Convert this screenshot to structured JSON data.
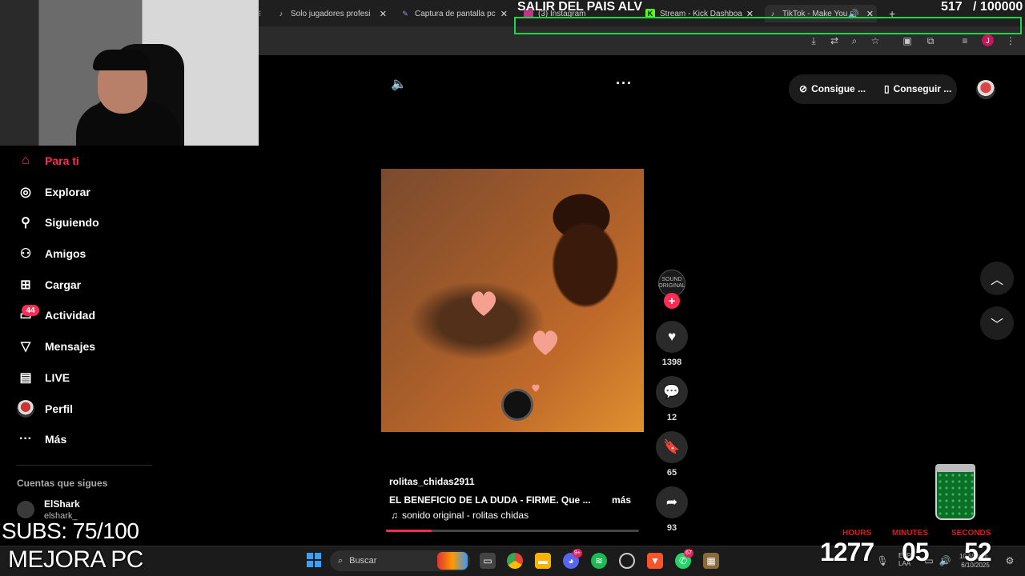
{
  "browser": {
    "tabs": [
      {
        "title": "Solo jugadores profesi",
        "icon": "tiktok-icon"
      },
      {
        "title": "Captura de pantalla pc",
        "icon": "pen-icon"
      },
      {
        "title": "(3) Instagram",
        "icon": "instagram-icon"
      },
      {
        "title": "Stream - Kick Dashboa",
        "icon": "kick-icon"
      },
      {
        "title": "TikTok - Make You",
        "icon": "tiktok-icon",
        "active": true
      }
    ],
    "new_tab_label": "+",
    "profile_initial": "J"
  },
  "overlay": {
    "title": "SALIR DEL PAIS ALV",
    "counter": "517   / 100000",
    "subs": "SUBS: 75/100",
    "brand": "MEJORA PC",
    "timer": {
      "hours_label": "HOURS",
      "minutes_label": "MINUTES",
      "seconds_label": "SECONDS",
      "hours": "1277",
      "minutes": "05",
      "seconds": "52"
    },
    "accent_color": "#1fd64a"
  },
  "header": {
    "get_coins": "Consigue ...",
    "get_app": "Conseguir ..."
  },
  "sidebar": {
    "items": [
      {
        "label": "Para ti",
        "icon": "home-icon",
        "active": true
      },
      {
        "label": "Explorar",
        "icon": "compass-icon"
      },
      {
        "label": "Siguiendo",
        "icon": "user-follow-icon"
      },
      {
        "label": "Amigos",
        "icon": "friends-icon"
      },
      {
        "label": "Cargar",
        "icon": "upload-icon"
      },
      {
        "label": "Actividad",
        "icon": "activity-icon",
        "badge": "44"
      },
      {
        "label": "Mensajes",
        "icon": "messages-icon"
      },
      {
        "label": "LIVE",
        "icon": "live-icon"
      },
      {
        "label": "Perfil",
        "icon": "profile-avatar"
      },
      {
        "label": "Más",
        "icon": "more-dots-icon"
      }
    ],
    "following_heading": "Cuentas que sigues",
    "following": [
      {
        "name": "ElShark",
        "handle": "elshark_"
      }
    ]
  },
  "video": {
    "username": "rolitas_chidas2911",
    "description": "EL BENEFICIO DE LA DUDA - FIRME. Que ...",
    "more_label": "más",
    "sound": "sonido original - rolitas chidas",
    "progress": 0.18,
    "creator_avatar_text": "SOUND ORIGINAL",
    "likes": "1398",
    "comments": "12",
    "saves": "65",
    "shares": "93"
  },
  "taskbar": {
    "search_placeholder": "Buscar",
    "lang": "ESP\nLAA",
    "time": "10:55 p.m.",
    "date": "6/10/2025",
    "discord_badge": "9+",
    "whatsapp_badge": "67"
  },
  "colors": {
    "tiktok_red": "#fe2c55",
    "timer_label": "#e01a1a"
  }
}
